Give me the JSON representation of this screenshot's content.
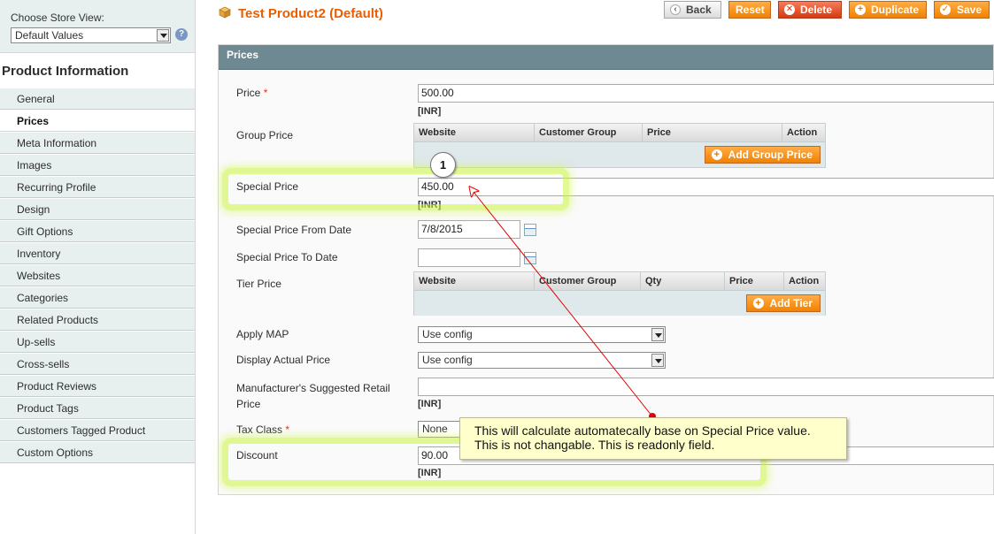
{
  "sidebar": {
    "store_view_label": "Choose Store View:",
    "store_view_value": "Default Values",
    "title": "Product Information",
    "tabs": [
      {
        "label": "General"
      },
      {
        "label": "Prices"
      },
      {
        "label": "Meta Information"
      },
      {
        "label": "Images"
      },
      {
        "label": "Recurring Profile"
      },
      {
        "label": "Design"
      },
      {
        "label": "Gift Options"
      },
      {
        "label": "Inventory"
      },
      {
        "label": "Websites"
      },
      {
        "label": "Categories"
      },
      {
        "label": "Related Products"
      },
      {
        "label": "Up-sells"
      },
      {
        "label": "Cross-sells"
      },
      {
        "label": "Product Reviews"
      },
      {
        "label": "Product Tags"
      },
      {
        "label": "Customers Tagged Product"
      },
      {
        "label": "Custom Options"
      }
    ],
    "active_tab": "Prices"
  },
  "header": {
    "title": "Test Product2 (Default)",
    "buttons": {
      "back": "Back",
      "reset": "Reset",
      "delete": "Delete",
      "duplicate": "Duplicate",
      "save": "Save"
    }
  },
  "prices": {
    "section_title": "Prices",
    "currency": "[INR]",
    "price": {
      "label": "Price",
      "required": "*",
      "value": "500.00"
    },
    "group_price": {
      "label": "Group Price",
      "columns": [
        "Website",
        "Customer Group",
        "Price",
        "Action"
      ],
      "add_button": "Add Group Price"
    },
    "special_price": {
      "label": "Special Price",
      "value": "450.00"
    },
    "special_from": {
      "label": "Special Price From Date",
      "value": "7/8/2015"
    },
    "special_to": {
      "label": "Special Price To Date",
      "value": ""
    },
    "tier_price": {
      "label": "Tier Price",
      "columns": [
        "Website",
        "Customer Group",
        "Qty",
        "Price",
        "Action"
      ],
      "add_button": "Add Tier"
    },
    "apply_map": {
      "label": "Apply MAP",
      "value": "Use config"
    },
    "display_actual_price": {
      "label": "Display Actual Price",
      "value": "Use config"
    },
    "msrp": {
      "label_line1": "Manufacturer's Suggested Retail",
      "label_line2": "Price",
      "value": ""
    },
    "tax_class": {
      "label": "Tax Class",
      "required": "*",
      "value": "None"
    },
    "discount": {
      "label": "Discount",
      "value": "90.00"
    }
  },
  "annotation": {
    "marker": "1",
    "callout_line1": "This will calculate automatecally base on Special Price value.",
    "callout_line2": "This is not changable. This is readonly field."
  },
  "colors": {
    "title": "#eb5e00",
    "section_header": "#6f8992",
    "button_orange": "#f18200",
    "button_delete": "#d63a0f",
    "highlight": "#c8f53c",
    "arrow": "#e00000",
    "callout_bg": "#ffffcc"
  },
  "icons": {
    "header": "package-icon",
    "help": "help-icon",
    "calendar": "calendar-icon",
    "add": "plus-circle-icon"
  }
}
